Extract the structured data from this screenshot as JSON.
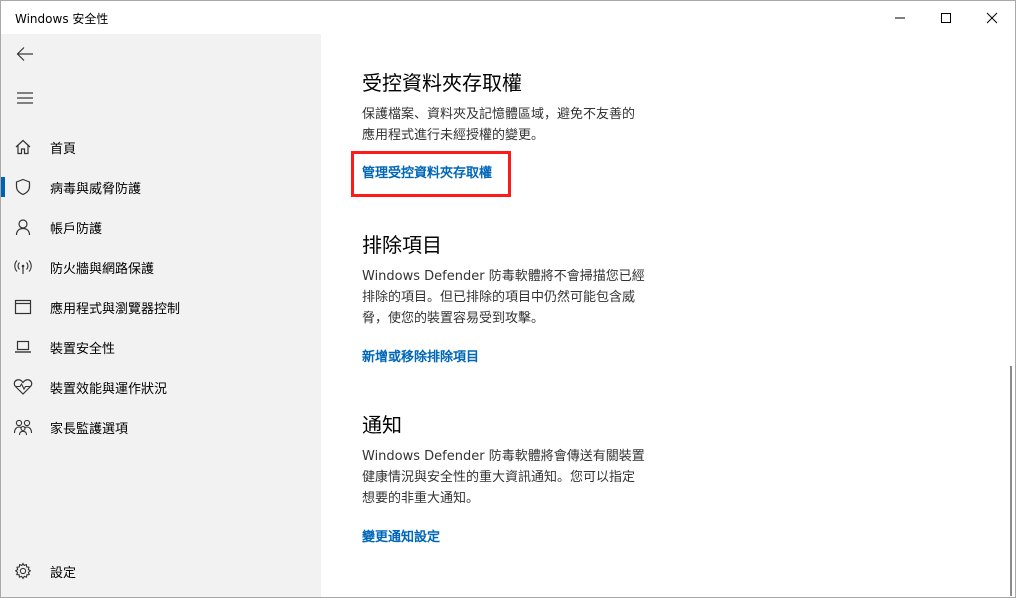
{
  "window": {
    "title": "Windows 安全性"
  },
  "sidebar": {
    "items": [
      {
        "label": "首頁",
        "icon": "home-icon"
      },
      {
        "label": "病毒與威脅防護",
        "icon": "shield-icon",
        "active": true
      },
      {
        "label": "帳戶防護",
        "icon": "person-icon"
      },
      {
        "label": "防火牆與網路保護",
        "icon": "wireless-icon"
      },
      {
        "label": "應用程式與瀏覽器控制",
        "icon": "app-window-icon"
      },
      {
        "label": "裝置安全性",
        "icon": "laptop-icon"
      },
      {
        "label": "裝置效能與運作狀況",
        "icon": "heart-pulse-icon"
      },
      {
        "label": "家長監護選項",
        "icon": "family-icon"
      }
    ],
    "settings_label": "設定"
  },
  "main": {
    "sections": [
      {
        "title": "受控資料夾存取權",
        "desc_lines": [
          "保護檔案、資料夾及記憶體區域，避免不友善的",
          "應用程式進行未經授權的變更。"
        ],
        "link": "管理受控資料夾存取權"
      },
      {
        "title": "排除項目",
        "desc_lines": [
          "Windows Defender 防毒軟體將不會掃描您已經",
          "排除的項目。但已排除的項目中仍然可能包含威",
          "脅，使您的裝置容易受到攻擊。"
        ],
        "link": "新增或移除排除項目"
      },
      {
        "title": "通知",
        "desc_lines": [
          "Windows Defender 防毒軟體將會傳送有關裝置",
          "健康情況與安全性的重大資訊通知。您可以指定",
          "想要的非重大通知。"
        ],
        "link": "變更通知設定"
      }
    ]
  },
  "colors": {
    "accent": "#0063b1",
    "link": "#0067b8",
    "highlight": "#ff1a1a",
    "sidebar_bg": "#f2f2f2"
  }
}
